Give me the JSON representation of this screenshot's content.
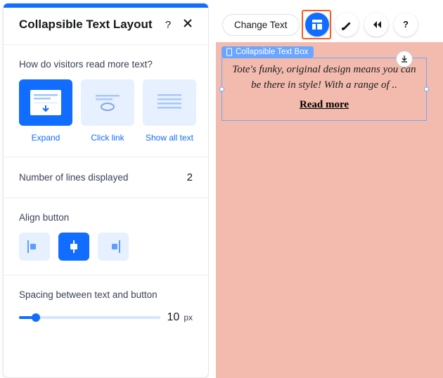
{
  "panel": {
    "title": "Collapsible Text Layout",
    "help_icon": "?",
    "read_label": "How do visitors read more text?",
    "modes": {
      "expand": "Expand",
      "clicklink": "Click link",
      "showall": "Show all text"
    },
    "lines_label": "Number of lines displayed",
    "lines_value": "2",
    "align_label": "Align button",
    "spacing_label": "Spacing between text and button",
    "spacing_value": "10",
    "spacing_unit": "px"
  },
  "toolbar": {
    "change_text": "Change Text"
  },
  "canvas": {
    "selection_label": "Collapsible Text Box",
    "body": "Tote's funky, original design means you can be there in style! With a range of ..",
    "read_more": "Read more"
  }
}
